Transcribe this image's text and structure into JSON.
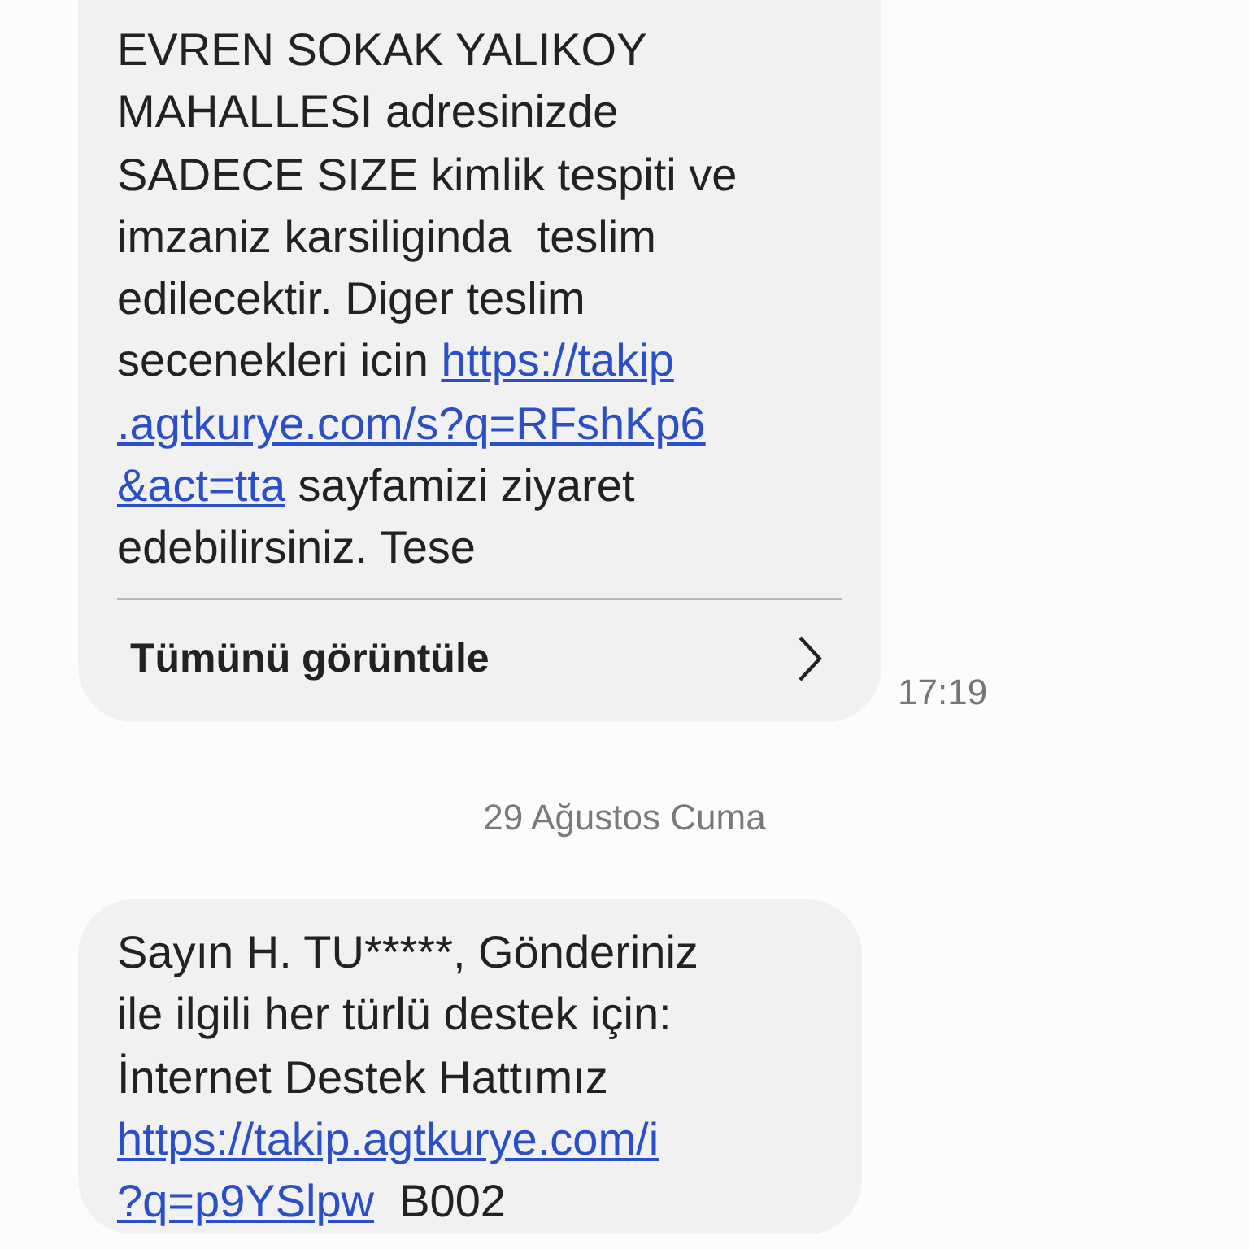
{
  "messages": [
    {
      "lines": [
        [
          {
            "kind": "text",
            "text": "EVREN SOKAK YALIKOY"
          }
        ],
        [
          {
            "kind": "text",
            "text": "MAHALLESI adresinizde"
          }
        ],
        [
          {
            "kind": "text",
            "text": "SADECE SIZE kimlik tespiti ve"
          }
        ],
        [
          {
            "kind": "text",
            "text": "imzaniz karsiliginda  teslim"
          }
        ],
        [
          {
            "kind": "text",
            "text": "edilecektir. Diger teslim"
          }
        ],
        [
          {
            "kind": "text",
            "text": "secenekleri icin "
          },
          {
            "kind": "link",
            "text": "https://takip"
          }
        ],
        [
          {
            "kind": "link",
            "text": ".agtkurye.com/s?q=RFshKp6"
          }
        ],
        [
          {
            "kind": "link",
            "text": "&act=tta"
          },
          {
            "kind": "text",
            "text": " sayfamizi ziyaret"
          }
        ],
        [
          {
            "kind": "text",
            "text": "edebilirsiniz. Tese"
          }
        ]
      ],
      "view_all": "Tümünü görüntüle",
      "time": "17:19"
    },
    {
      "date": "29 Ağustos Cuma"
    },
    {
      "lines": [
        [
          {
            "kind": "text",
            "text": "Sayın H. TU*****, Gönderiniz"
          }
        ],
        [
          {
            "kind": "text",
            "text": "ile ilgili her türlü destek için:"
          }
        ],
        [
          {
            "kind": "text",
            "text": "İnternet Destek Hattımız"
          }
        ],
        [
          {
            "kind": "link",
            "text": "https://takip.agtkurye.com/i"
          }
        ],
        [
          {
            "kind": "link",
            "text": "?q=p9YSlpw"
          },
          {
            "kind": "text",
            "text": "  B002"
          }
        ]
      ]
    }
  ]
}
